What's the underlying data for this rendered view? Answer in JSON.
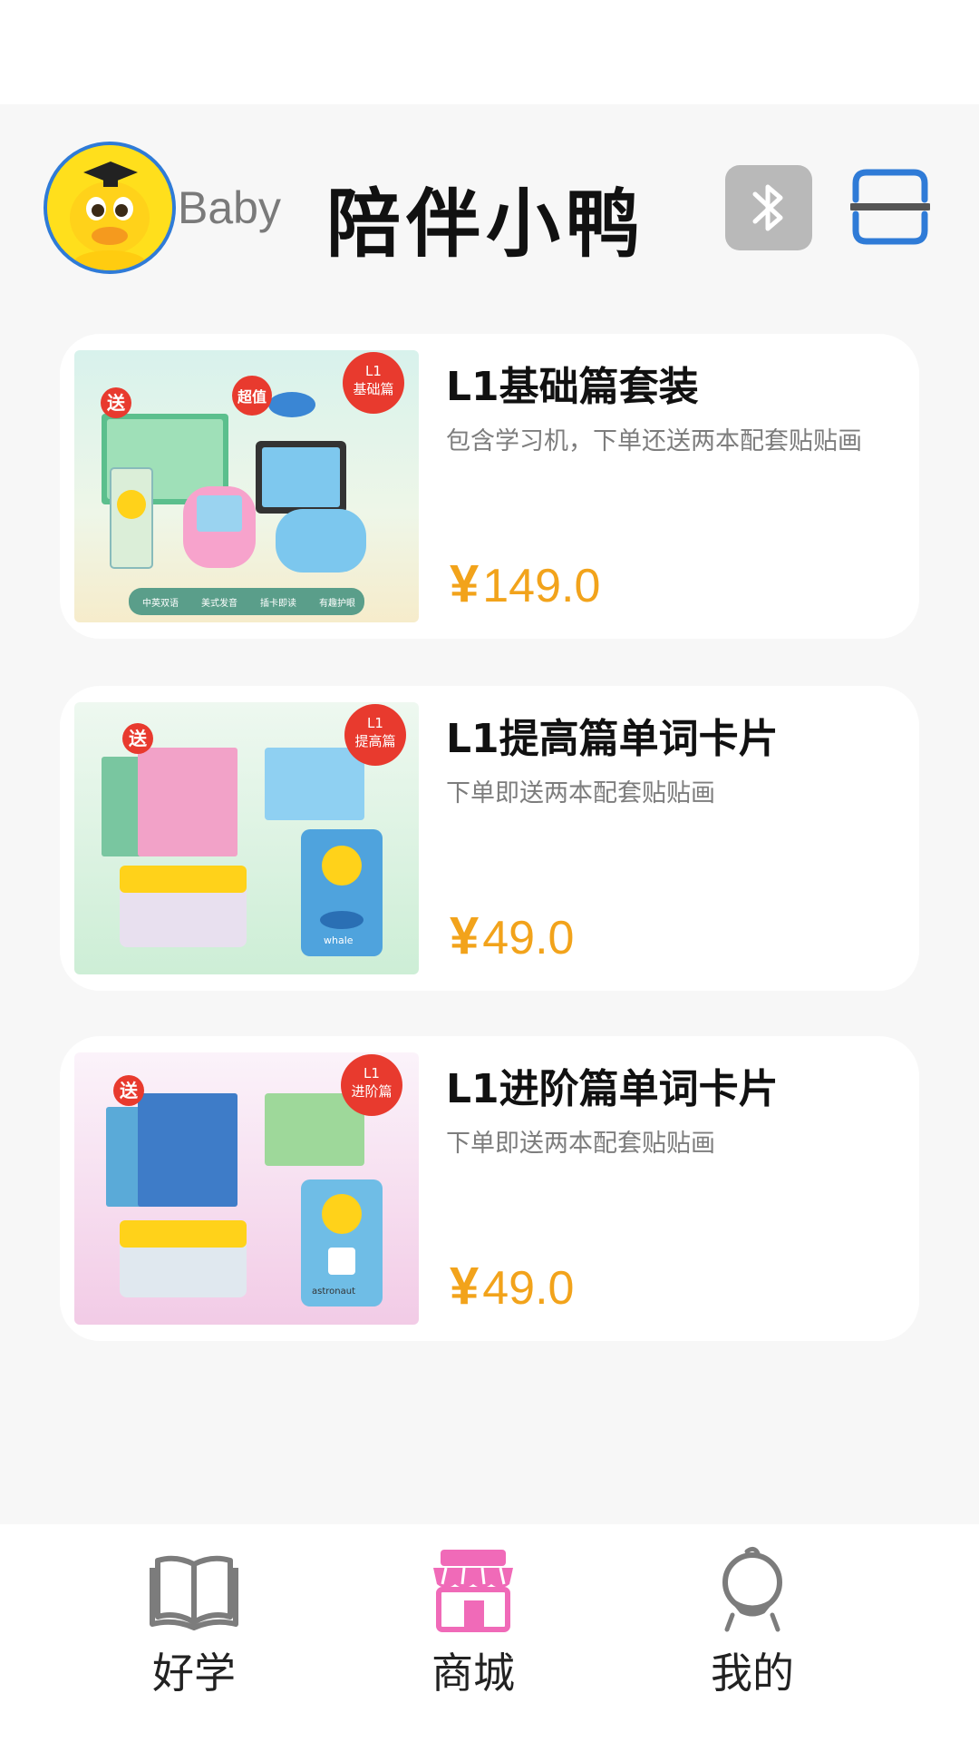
{
  "header": {
    "username": "Baby",
    "app_title": "陪伴小鸭"
  },
  "products": [
    {
      "title": "L1基础篇套装",
      "description": "包含学习机，下单还送两本配套贴贴画",
      "currency": "¥",
      "price": "149.0",
      "image_badges": {
        "gift": "送",
        "value": "超值",
        "level": "L1",
        "tier": "基础篇"
      },
      "image_features": [
        "中英双语",
        "美式发音",
        "插卡即读",
        "有趣护眼"
      ]
    },
    {
      "title": "L1提高篇单词卡片",
      "description": "下单即送两本配套贴贴画",
      "currency": "¥",
      "price": "49.0",
      "image_badges": {
        "gift": "送",
        "level": "L1",
        "tier": "提高篇"
      },
      "image_card_word": "whale"
    },
    {
      "title": "L1进阶篇单词卡片",
      "description": "下单即送两本配套贴贴画",
      "currency": "¥",
      "price": "49.0",
      "image_badges": {
        "gift": "送",
        "level": "L1",
        "tier": "进阶篇"
      },
      "image_card_word": "astronaut"
    }
  ],
  "bottom_nav": [
    {
      "label": "好学",
      "icon": "book-icon"
    },
    {
      "label": "商城",
      "icon": "shop-icon",
      "active": true
    },
    {
      "label": "我的",
      "icon": "duck-outline-icon"
    }
  ],
  "colors": {
    "price": "#f2a31b",
    "active_nav": "#f06ab8",
    "scan_blue": "#2f7bd7",
    "badge_red": "#e83a2e"
  }
}
